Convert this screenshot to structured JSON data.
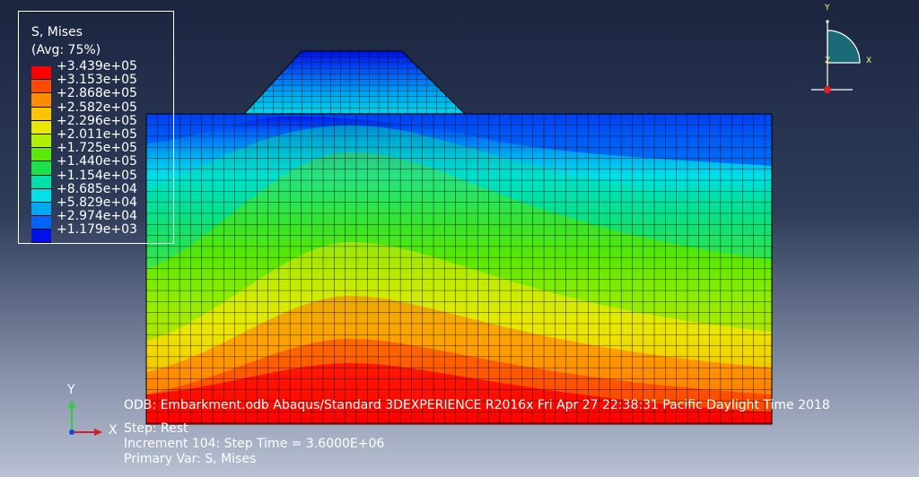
{
  "legend": {
    "title": "S, Mises",
    "averaging": "(Avg: 75%)",
    "labels": [
      "+3.439e+05",
      "+3.153e+05",
      "+2.868e+05",
      "+2.582e+05",
      "+2.296e+05",
      "+2.011e+05",
      "+1.725e+05",
      "+1.440e+05",
      "+1.154e+05",
      "+8.685e+04",
      "+5.829e+04",
      "+2.974e+04",
      "+1.179e+03"
    ],
    "colors": [
      "#ff0000",
      "#ff4a00",
      "#ff8c00",
      "#ffc400",
      "#e8e800",
      "#b0f000",
      "#5ce800",
      "#1ee04a",
      "#00e0a8",
      "#00e0e8",
      "#00a8f0",
      "#0064f8",
      "#0010e8"
    ]
  },
  "info": {
    "odb": "ODB: Embarkment.odb    Abaqus/Standard 3DEXPERIENCE R2016x    Fri Apr 27 22:38:31 Pacific Daylight Time 2018",
    "step": "Step: Rest",
    "increment": "Increment      104: Step Time =     3.6000E+06",
    "primary_var": "Primary Var: S, Mises"
  },
  "triad_top": {
    "y": "Y",
    "z": "Z",
    "x": "X"
  },
  "triad_bottom": {
    "y": "Y",
    "x": "X"
  },
  "colors": {
    "mesh": "#000000",
    "axis_y": "#2ecc40",
    "axis_x": "#d62020",
    "axis_z": "#2040e0"
  }
}
